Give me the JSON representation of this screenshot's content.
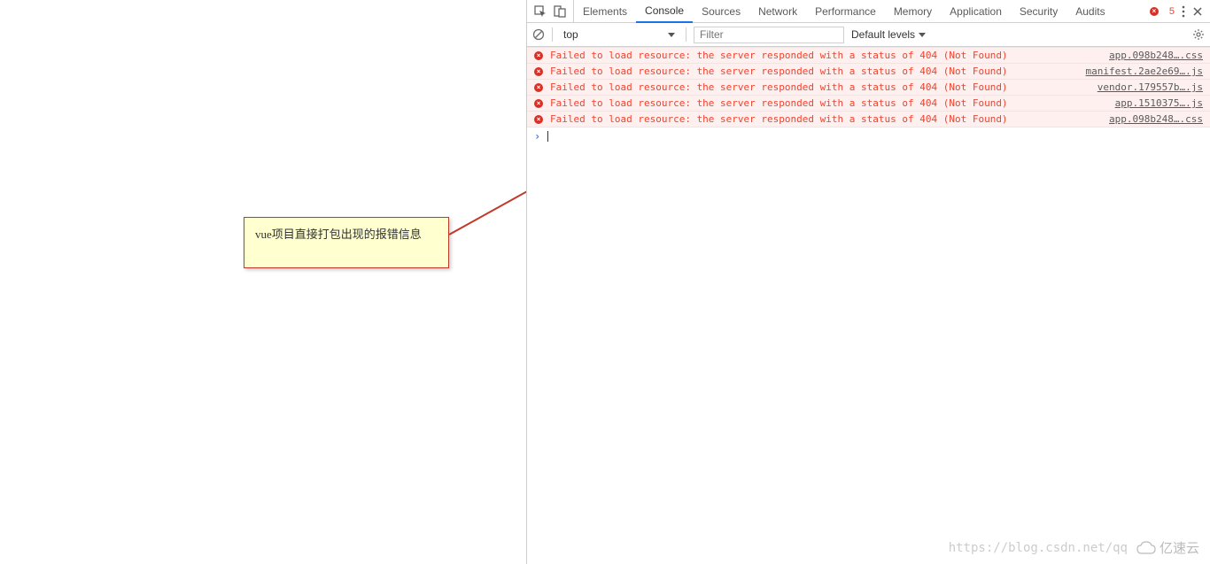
{
  "tabs": {
    "elements": "Elements",
    "console": "Console",
    "sources": "Sources",
    "network": "Network",
    "performance": "Performance",
    "memory": "Memory",
    "application": "Application",
    "security": "Security",
    "audits": "Audits"
  },
  "error_badge": "5",
  "toolbar": {
    "context": "top",
    "filter_placeholder": "Filter",
    "levels": "Default levels"
  },
  "errors": [
    {
      "msg": "Failed to load resource: the server responded with a status of 404 (Not Found)",
      "src": "app.098b248….css"
    },
    {
      "msg": "Failed to load resource: the server responded with a status of 404 (Not Found)",
      "src": "manifest.2ae2e69….js"
    },
    {
      "msg": "Failed to load resource: the server responded with a status of 404 (Not Found)",
      "src": "vendor.179557b….js"
    },
    {
      "msg": "Failed to load resource: the server responded with a status of 404 (Not Found)",
      "src": "app.1510375….js"
    },
    {
      "msg": "Failed to load resource: the server responded with a status of 404 (Not Found)",
      "src": "app.098b248….css"
    }
  ],
  "annotation": "vue项目直接打包出现的报错信息",
  "watermark_url": "https://blog.csdn.net/qq",
  "watermark_brand": "亿速云"
}
